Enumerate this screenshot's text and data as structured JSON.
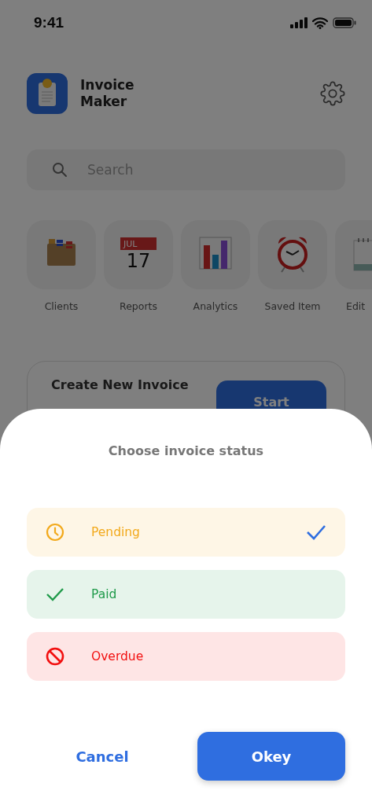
{
  "status_bar": {
    "time": "9:41"
  },
  "header": {
    "app_name": "Invoice Maker"
  },
  "search": {
    "placeholder": "Search"
  },
  "shortcuts": [
    {
      "kind": "clients",
      "label": "Clients"
    },
    {
      "kind": "calendar",
      "label": "Reports",
      "month": "JUL",
      "day": "17"
    },
    {
      "kind": "analytics",
      "label": "Analytics"
    },
    {
      "kind": "alarm",
      "label": "Saved Item"
    },
    {
      "kind": "notepad",
      "label": "Edit"
    }
  ],
  "create_card": {
    "title": "Create New Invoice",
    "button": "Start"
  },
  "sheet": {
    "title": "Choose invoice status",
    "options": [
      {
        "kind": "pending",
        "label": "Pending",
        "color": "#f2a91b",
        "selected": true
      },
      {
        "kind": "paid",
        "label": "Paid",
        "color": "#1f9a4a",
        "selected": false
      },
      {
        "kind": "overdue",
        "label": "Overdue",
        "color": "#f20f0f",
        "selected": false
      }
    ],
    "cancel": "Cancel",
    "confirm": "Okey"
  }
}
